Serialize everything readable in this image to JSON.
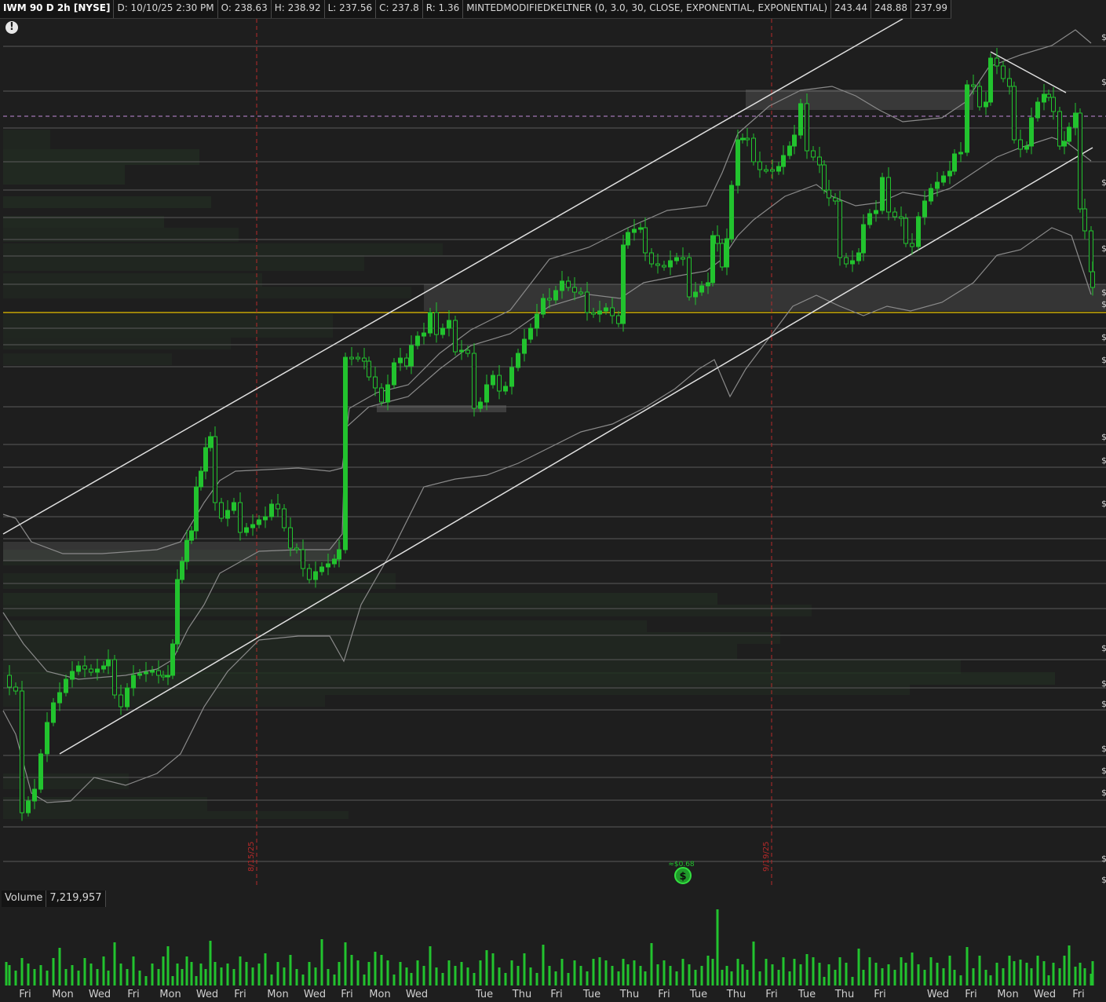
{
  "header": {
    "symbol": "IWM 90 D 2h [NYSE]",
    "date": "D: 10/10/25 2:30 PM",
    "open": "O: 238.63",
    "high": "H: 238.92",
    "low": "L: 237.56",
    "close": "C: 237.8",
    "range": "R: 1.36",
    "study": "MINTEDMODIFIEDKELTNER (0, 3.0, 30, CLOSE, EXPONENTIAL, EXPONENTIAL)",
    "study_upper": "243.44",
    "study_middle": "248.88",
    "study_lower": "237.99"
  },
  "alert_icon": "!",
  "volume_panel": {
    "label": "Volume",
    "value": "7,219,957"
  },
  "dividend_marker": {
    "label": "≈$0.68",
    "icon": "dividend-icon"
  },
  "date_markers": [
    "8/15/25",
    "9/19/25"
  ],
  "price_axis_symbol": "$",
  "time_axis": [
    "Fri",
    "Mon",
    "Wed",
    "Fri",
    "Mon",
    "Wed",
    "Fri",
    "Mon",
    "Wed",
    "Fri",
    "Mon",
    "Wed",
    "Tue",
    "Thu",
    "Fri",
    "Tue",
    "Thu",
    "Fri",
    "Tue",
    "Thu",
    "Fri",
    "Tue",
    "Thu",
    "Fri",
    "Wed",
    "Fri",
    "Mon",
    "Wed",
    "Fri"
  ],
  "colors": {
    "background": "#1e1e1e",
    "up": "#22c32e",
    "grid": "#5a5a5a",
    "keltner": "#8a8a8a",
    "trendline": "#e0e0e0",
    "last_price": "#e6c200",
    "marker": "#b52a2a"
  },
  "chart_data": {
    "type": "candlestick",
    "symbol": "IWM",
    "aggregation": "2h",
    "last": {
      "date": "10/10/25 2:30 PM",
      "open": 238.63,
      "high": 238.92,
      "low": 237.56,
      "close": 237.8,
      "range": 1.36
    },
    "study": {
      "name": "MINTEDMODIFIEDKELTNER",
      "params": [
        0,
        3.0,
        30,
        "CLOSE",
        "EXPONENTIAL",
        "EXPONENTIAL"
      ],
      "values": [
        243.44,
        248.88,
        237.99
      ]
    },
    "volume_last": 7219957,
    "dividend": 0.68,
    "vertical_markers": [
      "8/15/25",
      "9/19/25"
    ],
    "x_ticks": [
      "Fri",
      "Mon",
      "Wed",
      "Fri",
      "Mon",
      "Wed",
      "Fri",
      "Mon",
      "Wed",
      "Fri",
      "Mon",
      "Wed",
      "Tue",
      "Thu",
      "Fri",
      "Tue",
      "Thu",
      "Fri",
      "Tue",
      "Thu",
      "Fri",
      "Tue",
      "Thu",
      "Fri",
      "Wed",
      "Fri",
      "Mon",
      "Wed",
      "Fri"
    ],
    "grid": true
  }
}
